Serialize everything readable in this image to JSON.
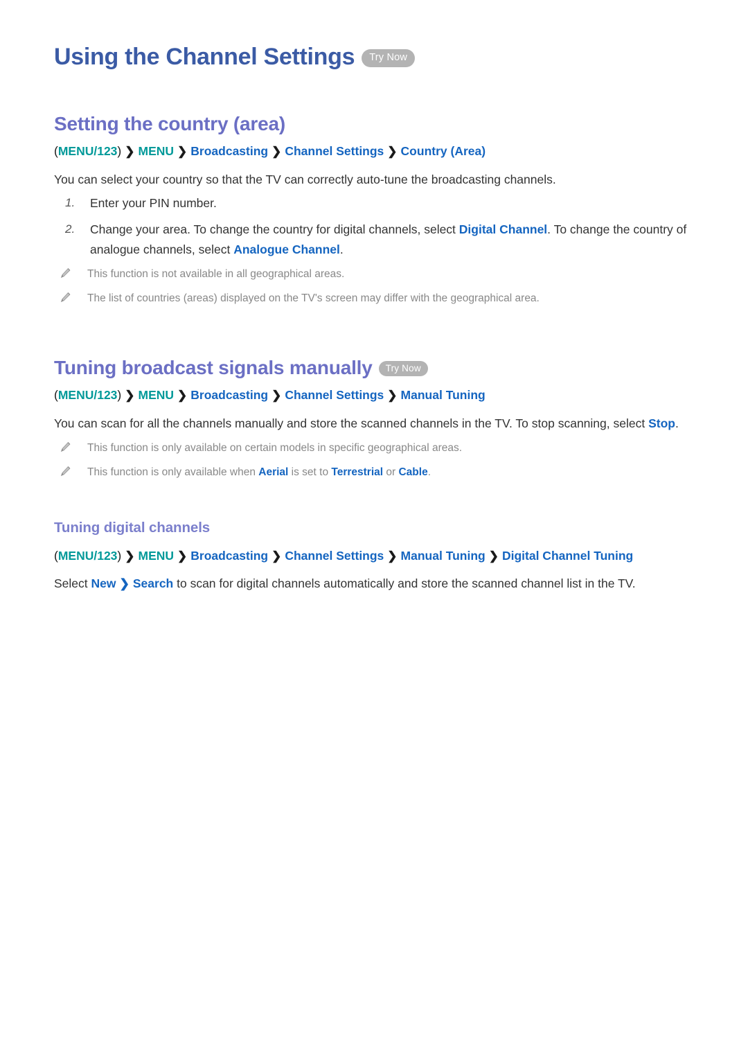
{
  "document": {
    "title": "Using the Channel Settings",
    "try_now_label": "Try Now"
  },
  "colors": {
    "title_blue": "#3B5BA5",
    "heading_purple": "#6B6FC4",
    "subheading_purple": "#7B7FCC",
    "link_blue": "#1565C0",
    "menu_teal": "#009999",
    "body_gray": "#333333",
    "note_gray": "#888888",
    "badge_gray": "#b3b3b3"
  },
  "sections": [
    {
      "heading": "Setting the country (area)",
      "has_try_now": false,
      "breadcrumb": {
        "open_paren": "(",
        "menu123": "MENU/123",
        "close_paren": ")",
        "chevron": "❯",
        "items": [
          "MENU",
          "Broadcasting",
          "Channel Settings",
          "Country (Area)"
        ]
      },
      "intro": "You can select your country so that the TV can correctly auto-tune the broadcasting channels.",
      "steps": [
        {
          "num": "1.",
          "parts": [
            {
              "t": "Enter your PIN number.",
              "hl": false
            }
          ]
        },
        {
          "num": "2.",
          "parts": [
            {
              "t": "Change your area. To change the country for digital channels, select ",
              "hl": false
            },
            {
              "t": "Digital Channel",
              "hl": true
            },
            {
              "t": ". To change the country of analogue channels, select ",
              "hl": false
            },
            {
              "t": "Analogue Channel",
              "hl": true
            },
            {
              "t": ".",
              "hl": false
            }
          ]
        }
      ],
      "notes": [
        {
          "icon": "pencil-icon",
          "parts": [
            {
              "t": "This function is not available in all geographical areas.",
              "hl": false
            }
          ]
        },
        {
          "icon": "pencil-icon",
          "parts": [
            {
              "t": "The list of countries (areas) displayed on the TV's screen may differ with the geographical area.",
              "hl": false
            }
          ]
        }
      ]
    },
    {
      "heading": "Tuning broadcast signals manually",
      "has_try_now": true,
      "try_now_label": "Try Now",
      "breadcrumb": {
        "open_paren": "(",
        "menu123": "MENU/123",
        "close_paren": ")",
        "chevron": "❯",
        "items": [
          "MENU",
          "Broadcasting",
          "Channel Settings",
          "Manual Tuning"
        ]
      },
      "intro_parts": [
        {
          "t": "You can scan for all the channels manually and store the scanned channels in the TV. To stop scanning, select ",
          "hl": false
        },
        {
          "t": "Stop",
          "hl": true
        },
        {
          "t": ".",
          "hl": false
        }
      ],
      "notes": [
        {
          "icon": "pencil-icon",
          "parts": [
            {
              "t": "This function is only available on certain models in specific geographical areas.",
              "hl": false
            }
          ]
        },
        {
          "icon": "pencil-icon",
          "parts": [
            {
              "t": "This function is only available when ",
              "hl": false
            },
            {
              "t": "Aerial",
              "hl": true
            },
            {
              "t": " is set to ",
              "hl": false
            },
            {
              "t": "Terrestrial",
              "hl": true
            },
            {
              "t": " or ",
              "hl": false
            },
            {
              "t": "Cable",
              "hl": true
            },
            {
              "t": ".",
              "hl": false
            }
          ]
        }
      ],
      "subsection": {
        "heading": "Tuning digital channels",
        "breadcrumb": {
          "open_paren": "(",
          "menu123": "MENU/123",
          "close_paren": ")",
          "chevron": "❯",
          "items": [
            "MENU",
            "Broadcasting",
            "Channel Settings",
            "Manual Tuning",
            "Digital Channel Tuning"
          ]
        },
        "body_parts": [
          {
            "t": "Select ",
            "hl": false
          },
          {
            "t": "New",
            "hl": true
          },
          {
            "t": " ❯ ",
            "hl": true
          },
          {
            "t": "Search",
            "hl": true
          },
          {
            "t": " to scan for digital channels automatically and store the scanned channel list in the TV.",
            "hl": false
          }
        ]
      }
    }
  ]
}
